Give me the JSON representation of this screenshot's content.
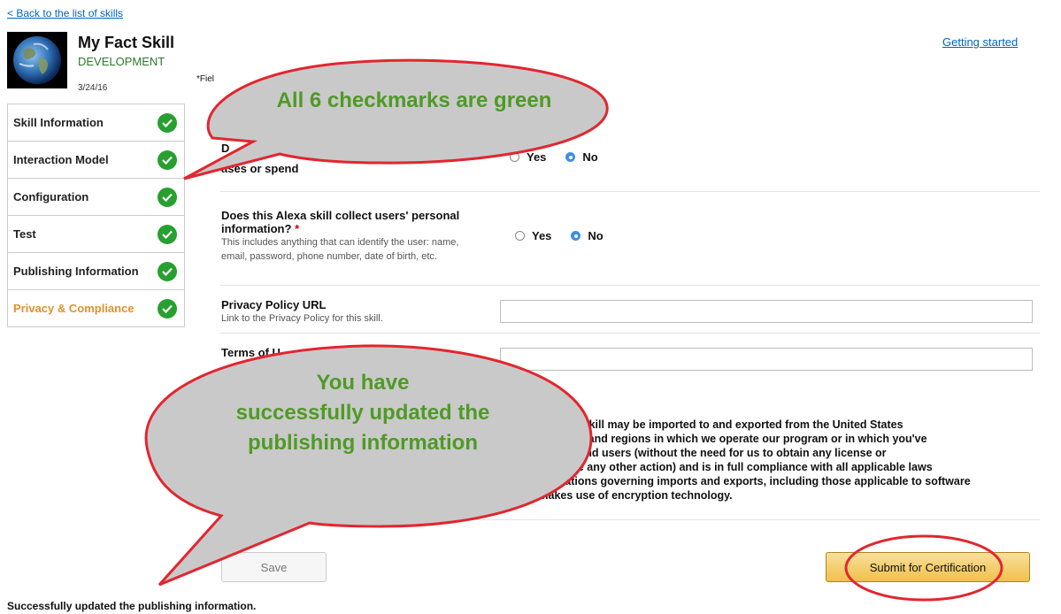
{
  "back_link": "< Back to the list of skills",
  "getting_started_link": "Getting started",
  "skill": {
    "name": "My Fact Skill",
    "stage": "DEVELOPMENT",
    "date": "3/24/16"
  },
  "required_note": "*Fiel",
  "nav": {
    "items": [
      {
        "label": "Skill Information",
        "complete": true,
        "active": false
      },
      {
        "label": "Interaction Model",
        "complete": true,
        "active": false
      },
      {
        "label": "Configuration",
        "complete": true,
        "active": false
      },
      {
        "label": "Test",
        "complete": true,
        "active": false
      },
      {
        "label": "Publishing Information",
        "complete": true,
        "active": false
      },
      {
        "label": "Privacy & Compliance",
        "complete": true,
        "active": true
      }
    ]
  },
  "questions": {
    "q1": {
      "title_fragment_top": "D",
      "title_fragment_bottom": "ases or spend",
      "yes_label": "Yes",
      "no_label": "No",
      "selected": "No"
    },
    "q2": {
      "title": "Does this Alexa skill collect users' personal information?",
      "required_star": "*",
      "help": "This includes anything that can identify the user: name, email, password, phone number, date of birth, etc.",
      "yes_label": "Yes",
      "no_label": "No",
      "selected": "No"
    },
    "privacy_policy": {
      "title": "Privacy Policy URL",
      "help": "Link to the Privacy Policy for this skill.",
      "value": ""
    },
    "terms": {
      "title_fragment": "Terms of U",
      "value": ""
    },
    "export_compliance": {
      "text": "at this Alexa skill may be imported to and exported from the United States\nher countries and regions in which we operate our program or in which you've\nted sales to end users (without the need for us to obtain any license or\nrance or take any other action) and is in full compliance with all applicable laws\nand regulations governing imports and exports, including those applicable to software\nthat makes use of encryption technology."
    }
  },
  "buttons": {
    "save": "Save",
    "submit": "Submit for Certification"
  },
  "status_message": "Successfully updated the publishing information.",
  "callouts": {
    "checkmarks": "All 6 checkmarks are green",
    "updated_line1": "You have",
    "updated_line2": "successfully updated the",
    "updated_line3": "publishing information"
  },
  "colors": {
    "callout_fill": "#c9c9c9",
    "callout_stroke": "#e2262f",
    "callout_text": "#4f9a26",
    "check_green": "#27a02f",
    "active_nav": "#e4902a",
    "link": "#0066c0"
  },
  "icons": {
    "check": "checkmark-icon",
    "earth": "earth-thumbnail"
  }
}
